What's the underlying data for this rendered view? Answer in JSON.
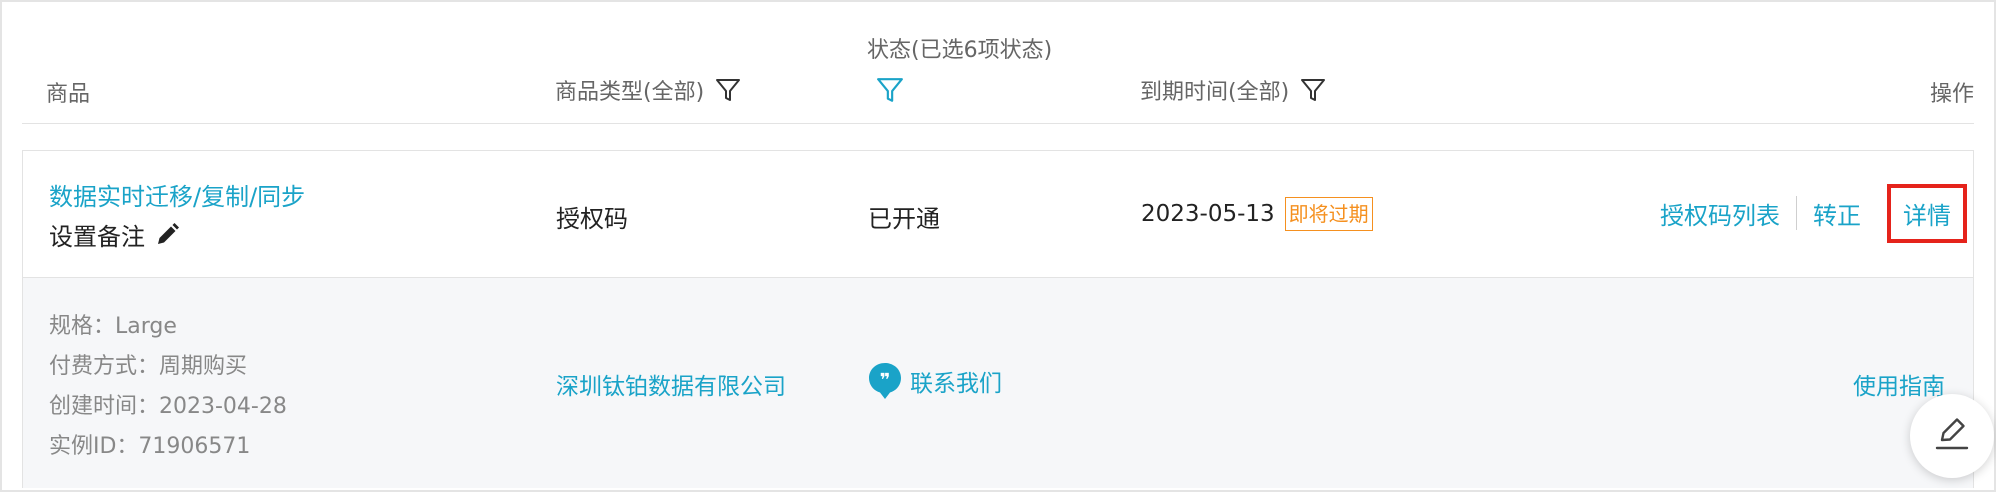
{
  "header": {
    "product": "商品",
    "product_type": "商品类型(全部)",
    "status": "状态(已选6项状态)",
    "expire_time": "到期时间(全部)",
    "action": "操作"
  },
  "row": {
    "product_name": "数据实时迁移/复制/同步",
    "remark_label": "设置备注",
    "product_type": "授权码",
    "status": "已开通",
    "expire_date": "2023-05-13",
    "expire_badge": "即将过期",
    "actions": {
      "license_list": "授权码列表",
      "convert": "转正",
      "detail": "详情"
    },
    "details": {
      "spec": "规格：Large",
      "billing": "付费方式：周期购买",
      "created": "创建时间：2023-04-28",
      "instance_id": "实例ID：71906571"
    },
    "company": "深圳钛铂数据有限公司",
    "contact": "联系我们",
    "guide": "使用指南"
  },
  "colors": {
    "link": "#1aa3c8",
    "warning": "#f5901f",
    "highlight": "#e5231b"
  },
  "icons": [
    "filter-icon",
    "pencil-icon",
    "chat-bubble-icon",
    "edit-icon"
  ]
}
